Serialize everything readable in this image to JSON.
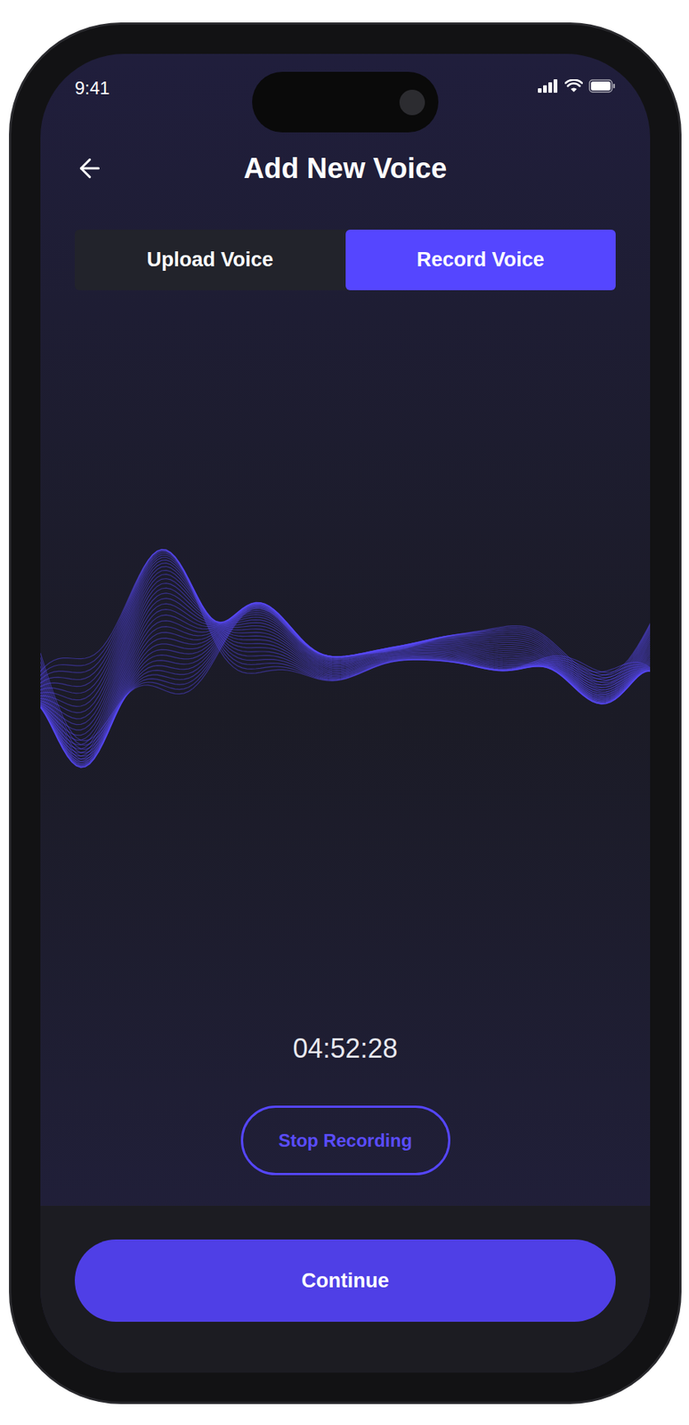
{
  "status_bar": {
    "time": "9:41"
  },
  "header": {
    "title": "Add New Voice"
  },
  "tabs": [
    {
      "label": "Upload Voice",
      "selected": false
    },
    {
      "label": "Record Voice",
      "selected": true
    }
  ],
  "recording": {
    "active": true,
    "timer": "04:52:28",
    "stop_button": "Stop Recording"
  },
  "buttons": [
    "Continue"
  ]
}
